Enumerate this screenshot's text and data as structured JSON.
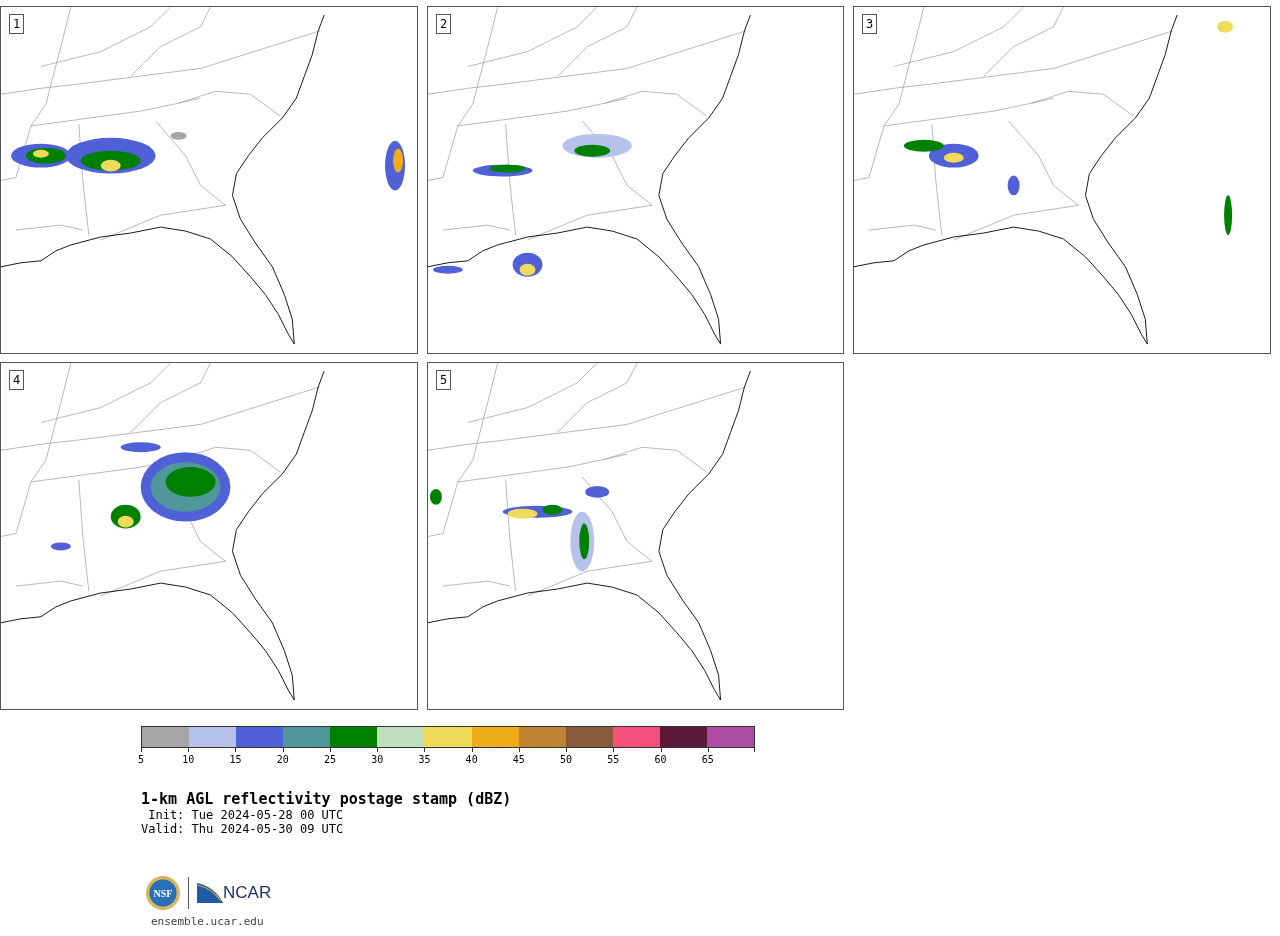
{
  "panels": [
    {
      "label": "1"
    },
    {
      "label": "2"
    },
    {
      "label": "3"
    },
    {
      "label": "4"
    },
    {
      "label": "5"
    }
  ],
  "colorbar": {
    "bins": [
      {
        "color": "#a5a5a5",
        "label": "5"
      },
      {
        "color": "#b6c2ec",
        "label": "10"
      },
      {
        "color": "#5060d6",
        "label": "15"
      },
      {
        "color": "#4f979b",
        "label": "20"
      },
      {
        "color": "#008000",
        "label": "25"
      },
      {
        "color": "#bfdfbe",
        "label": "30"
      },
      {
        "color": "#f0da5a",
        "label": "35"
      },
      {
        "color": "#f0ac1a",
        "label": "40"
      },
      {
        "color": "#bd8431",
        "label": "45"
      },
      {
        "color": "#8a5a3c",
        "label": "50"
      },
      {
        "color": "#f4507c",
        "label": "55"
      },
      {
        "color": "#5c1837",
        "label": "60"
      },
      {
        "color": "#ad4ca5",
        "label": "65"
      }
    ]
  },
  "title": "1-km AGL reflectivity postage stamp (dBZ)",
  "init": " Init: Tue 2024-05-28 00 UTC",
  "valid": "Valid: Thu 2024-05-30 09 UTC",
  "logos": {
    "nsf": "NSF",
    "ncar": "NCAR"
  },
  "footer_link": "ensemble.ucar.edu"
}
